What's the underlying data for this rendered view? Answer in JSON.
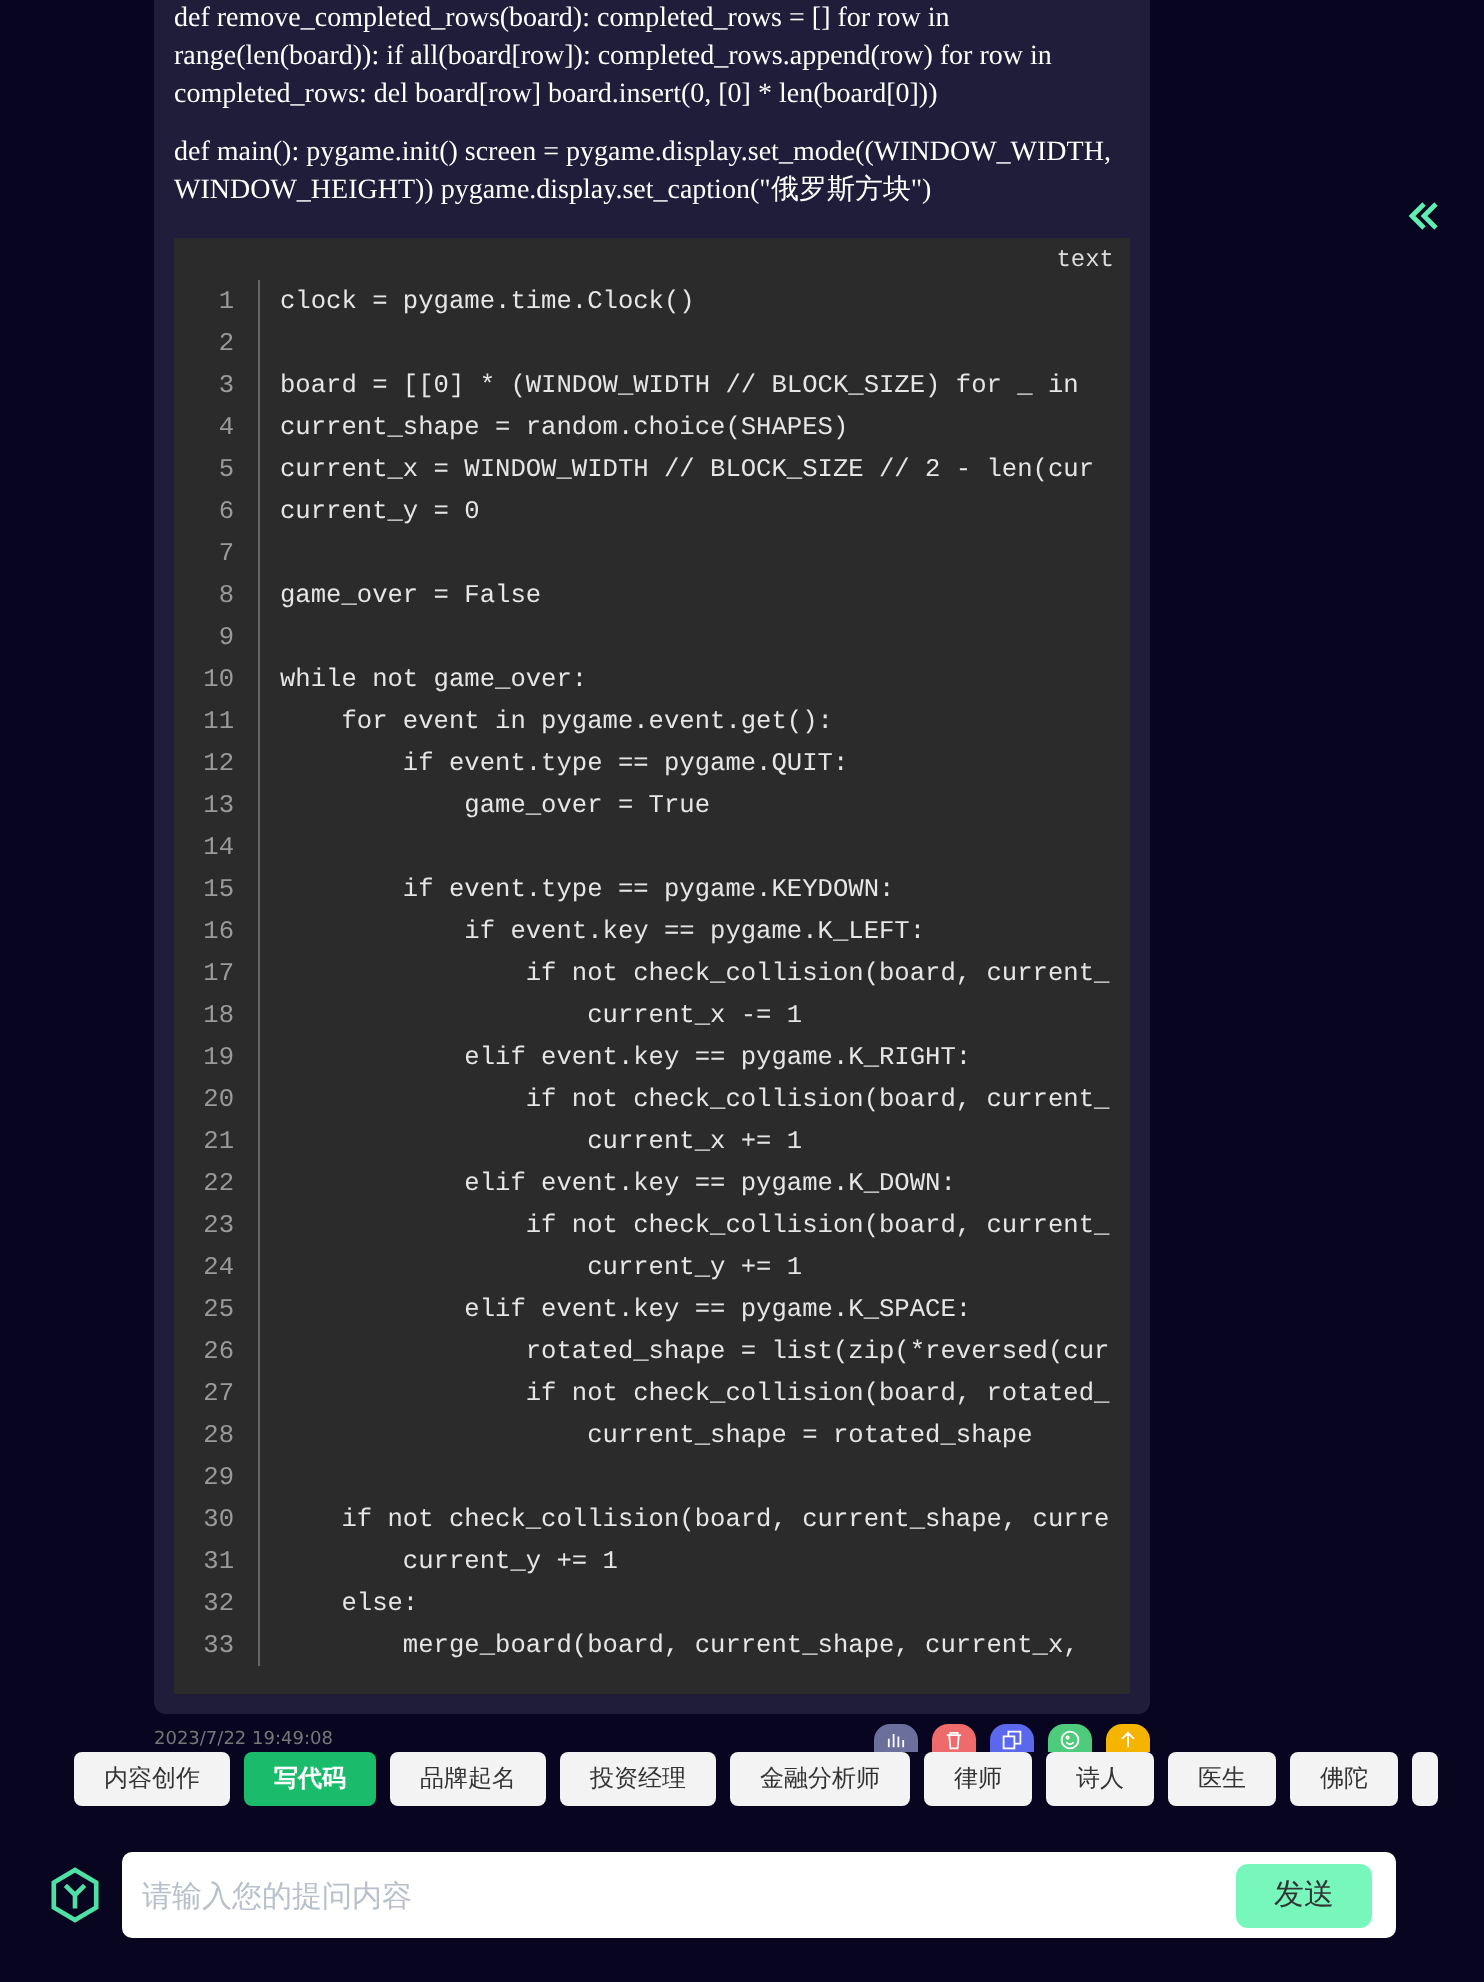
{
  "message": {
    "paragraphs": [
      "def remove_completed_rows(board): completed_rows = [] for row in range(len(board)): if all(board[row]): completed_rows.append(row) for row in completed_rows: del board[row] board.insert(0, [0] * len(board[0]))",
      "def main(): pygame.init() screen = pygame.display.set_mode((WINDOW_WIDTH, WINDOW_HEIGHT)) pygame.display.set_caption(\"俄罗斯方块\")"
    ],
    "code_block": {
      "language": "text",
      "lines": [
        {
          "number": "1",
          "code": "clock = pygame.time.Clock()"
        },
        {
          "number": "2"
        },
        {
          "number": "3",
          "code": "board = [[0] * (WINDOW_WIDTH // BLOCK_SIZE) for _ in"
        },
        {
          "number": "4",
          "code": "current_shape = random.choice(SHAPES)"
        },
        {
          "number": "5",
          "code": "current_x = WINDOW_WIDTH // BLOCK_SIZE // 2 - len(cur"
        },
        {
          "number": "6",
          "code": "current_y = 0"
        },
        {
          "number": "7"
        },
        {
          "number": "8",
          "code": "game_over = False"
        },
        {
          "number": "9"
        },
        {
          "number": "10",
          "code": "while not game_over:"
        },
        {
          "number": "11",
          "code": "    for event in pygame.event.get():"
        },
        {
          "number": "12",
          "code": "        if event.type == pygame.QUIT:"
        },
        {
          "number": "13",
          "code": "            game_over = True"
        },
        {
          "number": "14"
        },
        {
          "number": "15",
          "code": "        if event.type == pygame.KEYDOWN:"
        },
        {
          "number": "16",
          "code": "            if event.key == pygame.K_LEFT:"
        },
        {
          "number": "17",
          "code": "                if not check_collision(board, current_"
        },
        {
          "number": "18",
          "code": "                    current_x -= 1"
        },
        {
          "number": "19",
          "code": "            elif event.key == pygame.K_RIGHT:"
        },
        {
          "number": "20",
          "code": "                if not check_collision(board, current_"
        },
        {
          "number": "21",
          "code": "                    current_x += 1"
        },
        {
          "number": "22",
          "code": "            elif event.key == pygame.K_DOWN:"
        },
        {
          "number": "23",
          "code": "                if not check_collision(board, current_"
        },
        {
          "number": "24",
          "code": "                    current_y += 1"
        },
        {
          "number": "25",
          "code": "            elif event.key == pygame.K_SPACE:"
        },
        {
          "number": "26",
          "code": "                rotated_shape = list(zip(*reversed(cur"
        },
        {
          "number": "27",
          "code": "                if not check_collision(board, rotated_"
        },
        {
          "number": "28",
          "code": "                    current_shape = rotated_shape"
        },
        {
          "number": "29"
        },
        {
          "number": "30",
          "code": "    if not check_collision(board, current_shape, curre"
        },
        {
          "number": "31",
          "code": "        current_y += 1"
        },
        {
          "number": "32",
          "code": "    else:"
        },
        {
          "number": "33",
          "code": "        merge_board(board, current_shape, current_x, "
        }
      ]
    },
    "timestamp": "2023/7/22 19:49:08",
    "actions": [
      {
        "color": "#6b6f9c"
      },
      {
        "color": "#ef6b6b"
      },
      {
        "color": "#5b68ee"
      },
      {
        "color": "#4fcb7c"
      },
      {
        "color": "#f5b400"
      }
    ]
  },
  "roles": [
    {
      "label": "内容创作",
      "selected": false
    },
    {
      "label": "写代码",
      "selected": true
    },
    {
      "label": "品牌起名",
      "selected": false
    },
    {
      "label": "投资经理",
      "selected": false
    },
    {
      "label": "金融分析师",
      "selected": false
    },
    {
      "label": "律师",
      "selected": false
    },
    {
      "label": "诗人",
      "selected": false
    },
    {
      "label": "医生",
      "selected": false
    },
    {
      "label": "佛陀",
      "selected": false
    }
  ],
  "input": {
    "placeholder": "请输入您的提问内容",
    "send": "发送"
  }
}
